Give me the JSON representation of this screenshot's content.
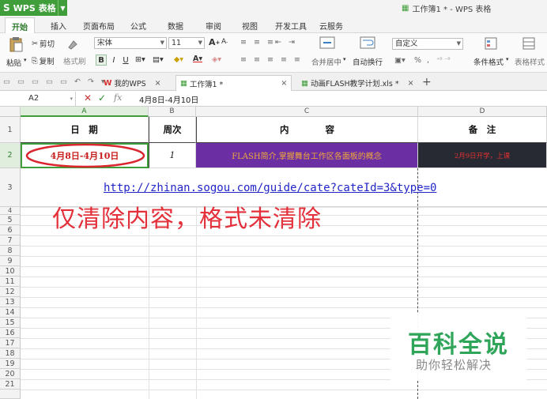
{
  "app": {
    "button_label": "WPS 表格",
    "logo_glyph": "S",
    "window_title": "工作簿1 * - WPS 表格"
  },
  "menu": {
    "tabs": [
      "开始",
      "插入",
      "页面布局",
      "公式",
      "数据",
      "审阅",
      "视图",
      "开发工具",
      "云服务"
    ],
    "active": "开始"
  },
  "ribbon": {
    "paste_label": "粘贴",
    "cut_label": "剪切",
    "copy_label": "复制",
    "format_painter_label": "格式刷",
    "font_name": "宋体",
    "font_size": "11",
    "bold": "B",
    "italic": "I",
    "underline": "U",
    "merge_label": "合并居中",
    "wrap_label": "自动换行",
    "number_format": "自定义",
    "percent": "%",
    "thousands": ",",
    "cond_format_label": "条件格式",
    "table_style_label": "表格样式"
  },
  "doc_tabs": [
    {
      "label": "我的WPS",
      "icon": "wps-w-icon"
    },
    {
      "label": "工作簿1 *",
      "icon": "sheet-icon"
    },
    {
      "label": "动画FLASH教学计划.xls *",
      "icon": "sheet-icon"
    }
  ],
  "formula_bar": {
    "name_box": "A2",
    "fx": "fx",
    "value": "4月8日-4月10日"
  },
  "columns": [
    "A",
    "B",
    "C",
    "D"
  ],
  "rows": [
    "1",
    "2",
    "3",
    "4",
    "5",
    "6",
    "7",
    "8",
    "9",
    "10",
    "11",
    "12",
    "13",
    "14",
    "15",
    "16",
    "17",
    "18",
    "19",
    "20",
    "21"
  ],
  "cells": {
    "a1": "日　期",
    "b1": "周次",
    "c1": "内　　　　容",
    "d1": "备　注",
    "a2": "4月8日-4月10日",
    "b2": "1",
    "c2": "FLASH简介,掌握舞台工作区各面板的概念",
    "d2": "2月9日开学，上课",
    "row3_link": "http://zhinan.sogou.com/guide/cate?cateId=3&type=0"
  },
  "annotation": "仅清除内容，格式未清除",
  "watermark": {
    "title": "百科全说",
    "subtitle": "助你轻松解决"
  },
  "colors": {
    "accent": "#3f9e3a",
    "c2_fill": "#6c2fa3",
    "c2_text": "#f1a93a",
    "d2_fill": "#272a33",
    "d2_text": "#e23030",
    "annot": "#e3303a"
  }
}
